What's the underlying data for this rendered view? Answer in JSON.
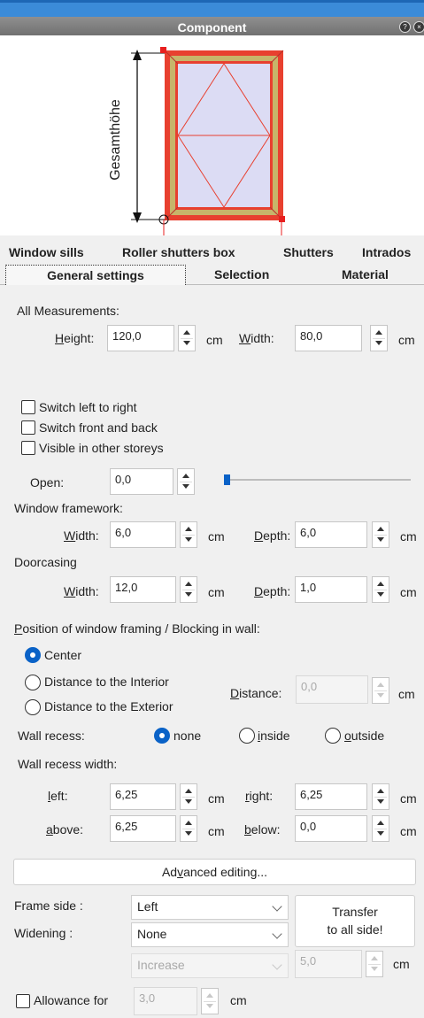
{
  "window": {
    "title": "Component"
  },
  "preview": {
    "dimension_label": "Gesamthöhe"
  },
  "tabs": {
    "row1": [
      "Window sills",
      "Roller shutters box",
      "Shutters",
      "Intrados"
    ],
    "row2": [
      "General settings",
      "Selection",
      "Material"
    ],
    "active": "General settings"
  },
  "all_measurements": {
    "section_label": "All Measurements:",
    "height_label": "Height:",
    "height_value": "120,0",
    "width_label": "Width:",
    "width_value": "80,0",
    "unit": "cm"
  },
  "options": {
    "switch_lr": "Switch left to right",
    "switch_fb": "Switch front and back",
    "visible_other": "Visible in other storeys"
  },
  "open": {
    "label": "Open:",
    "value": "0,0",
    "slider_fraction": 0
  },
  "window_framework": {
    "label": "Window framework:",
    "width_label": "Width:",
    "width_value": "6,0",
    "depth_label": "Depth:",
    "depth_value": "6,0",
    "unit": "cm"
  },
  "doorcasing": {
    "label": "Doorcasing",
    "width_label": "Width:",
    "width_value": "12,0",
    "depth_label": "Depth:",
    "depth_value": "1,0",
    "unit": "cm"
  },
  "position": {
    "label": "Position of window framing / Blocking in wall:",
    "center": "Center",
    "interior": "Distance to the Interior",
    "exterior": "Distance to the Exterior",
    "distance_label": "Distance:",
    "distance_value": "0,0",
    "unit": "cm",
    "selected": "center"
  },
  "wall_recess": {
    "label": "Wall recess:",
    "none": "none",
    "inside": "inside",
    "outside": "outside",
    "selected": "none"
  },
  "wall_recess_width": {
    "label": "Wall recess width:",
    "left_label": "left:",
    "left_value": "6,25",
    "right_label": "right:",
    "right_value": "6,25",
    "above_label": "above:",
    "above_value": "6,25",
    "below_label": "below:",
    "below_value": "0,0",
    "unit": "cm"
  },
  "advanced_button": "Advanced editing...",
  "frame": {
    "side_label": "Frame side :",
    "side_value": "Left",
    "widening_label": "Widening :",
    "widening_value": "None",
    "mode_value": "Increase",
    "amount_value": "5,0",
    "unit": "cm",
    "transfer_line1": "Transfer",
    "transfer_line2": "to all side!"
  },
  "allowance": {
    "label": "Allowance for",
    "value": "3,0",
    "unit": "cm"
  },
  "colors": {
    "accent": "#0a62c7",
    "frame_red": "#e8402f",
    "frame_gold": "#c7b56a",
    "glass": "#dcdcf4"
  }
}
